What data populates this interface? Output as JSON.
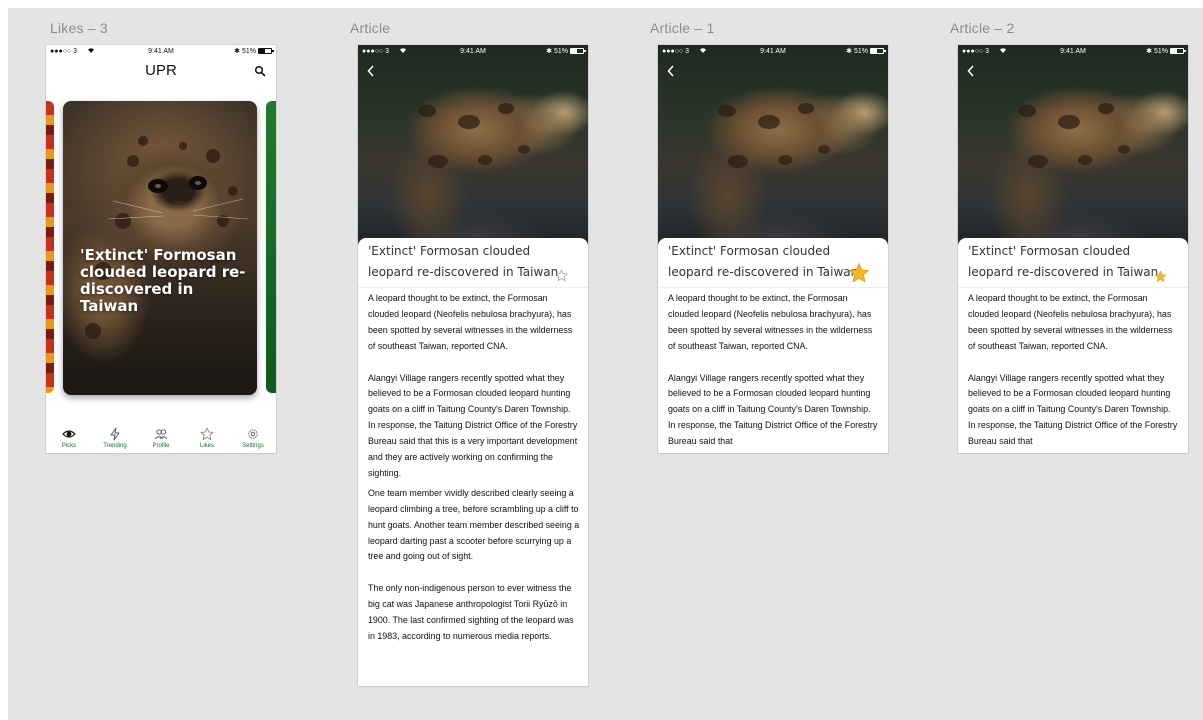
{
  "frames": {
    "likes_label": "Likes – 3",
    "article_label": "Article",
    "article1_label": "Article – 1",
    "article2_label": "Article – 2"
  },
  "status": {
    "carrier": "●●●○○ 3",
    "time": "9:41 AM",
    "battery": "51%"
  },
  "likes": {
    "app_title": "UPR",
    "card_headline": "'Extinct' Formosan clouded leopard re-discovered in Taiwan",
    "tabs": [
      {
        "label": "Picks",
        "icon": "eye-icon"
      },
      {
        "label": "Trending",
        "icon": "lightning-icon"
      },
      {
        "label": "Profile",
        "icon": "people-icon"
      },
      {
        "label": "Likes",
        "icon": "star-outline-icon"
      },
      {
        "label": "Settings",
        "icon": "gear-icon"
      }
    ]
  },
  "article": {
    "title": "'Extinct' Formosan clouded leopard re-discovered in Taiwan",
    "p1": "A leopard thought to be extinct, the Formosan clouded leopard (Neofelis nebulosa brachyura), has been spotted by several witnesses in the wilderness of southeast Taiwan, reported CNA.",
    "p2": "Alangyi Village rangers recently spotted what they believed to be a Formosan clouded leopard hunting goats on a cliff in Taitung County's Daren Township. In response, the Taitung District Office of the Forestry Bureau said that this is a very important development and they are actively working on confirming the sighting.",
    "p2_short": "Alangyi Village rangers recently spotted what they believed to be a Formosan clouded leopard hunting goats on a cliff in Taitung County's Daren Township. In response, the Taitung District Office of the Forestry Bureau said that",
    "p3": "One team member vividly described clearly seeing a leopard climbing a tree, before scrambling up a cliff to hunt goats. Another team member described seeing a leopard darting past a scooter before scurrying up a tree and going out of sight.",
    "p4": "The only non-indigenous person to ever witness the big cat was Japanese anthropologist Torii Ryūzō in 1900. The last confirmed sighting of the leopard was in 1983, according to numerous media reports."
  },
  "colors": {
    "accent_green": "#1a6b2a",
    "star_gold": "#f5b722",
    "canvas_gray": "#e4e4e4"
  }
}
